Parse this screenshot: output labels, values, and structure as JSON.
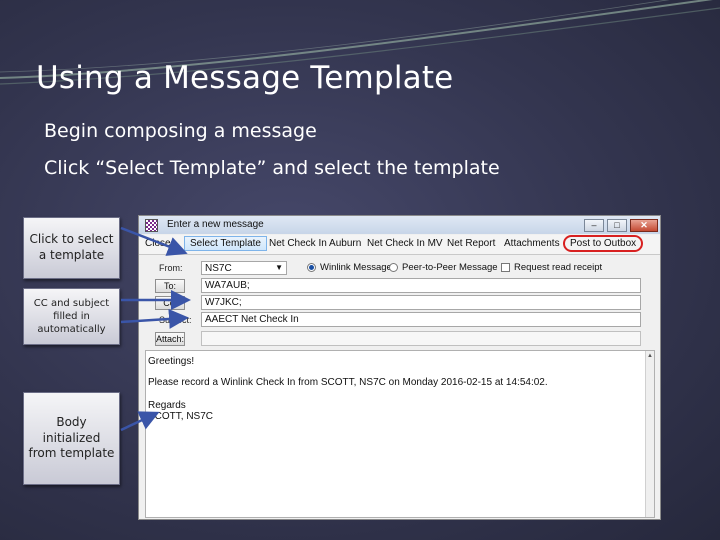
{
  "slide": {
    "title": "Using a Message Template",
    "bullets": [
      "Begin composing a message",
      "Click “Select Template” and select the template"
    ]
  },
  "callouts": [
    {
      "text": "Click to select a template"
    },
    {
      "text": "CC and subject filled in automatically"
    },
    {
      "text": "Body initialized from template"
    }
  ],
  "window": {
    "title": "Enter a new message",
    "controls": {
      "minimize": "–",
      "maximize": "□",
      "close": "✕"
    },
    "toolbar": [
      "Close",
      "Select Template",
      "Net Check In Auburn",
      "Net Check In MV",
      "Net Report",
      "Attachments",
      "Post to Outbox"
    ],
    "from_label": "From:",
    "from_value": "NS7C",
    "options": [
      "Winlink Message",
      "Peer-to-Peer Message"
    ],
    "request_receipt": "Request read receipt",
    "to_button": "To:",
    "to_value": "WA7AUB;",
    "cc_button": "Cc:",
    "cc_value": "W7JKC;",
    "subject_label": "Subject:",
    "subject_value": "AAECT Net Check In",
    "attach_button": "Attach:",
    "body": {
      "greeting": "Greetings!",
      "line": "Please record a Winlink Check In from SCOTT, NS7C on Monday 2016-02-15 at 14:54:02.",
      "regards": "Regards",
      "signature": "SCOTT, NS7C"
    }
  },
  "colors": {
    "highlight_ring": "#d82020",
    "slide_bg": "#33354f"
  }
}
